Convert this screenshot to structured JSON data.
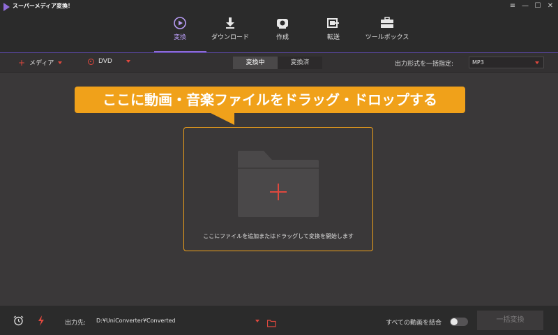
{
  "app": {
    "title": "スーパーメディア変換！"
  },
  "window_controls": [
    {
      "name": "menu-icon",
      "glyph": "≡"
    },
    {
      "name": "minimize-icon",
      "glyph": "—"
    },
    {
      "name": "maximize-icon",
      "glyph": "☐"
    },
    {
      "name": "close-icon",
      "glyph": "✕"
    }
  ],
  "nav": {
    "items": [
      {
        "id": "convert",
        "label": "変換",
        "icon": "play-circle-icon",
        "active": true
      },
      {
        "id": "download",
        "label": "ダウンロード",
        "icon": "download-icon",
        "active": false
      },
      {
        "id": "create",
        "label": "作成",
        "icon": "record-icon",
        "active": false
      },
      {
        "id": "transfer",
        "label": "転送",
        "icon": "transfer-icon",
        "active": false
      },
      {
        "id": "toolbox",
        "label": "ツールボックス",
        "icon": "toolbox-icon",
        "active": false
      }
    ]
  },
  "toolbar": {
    "media_label": "メディア",
    "dvd_label": "DVD",
    "tabs": [
      {
        "label": "変換中",
        "active": true
      },
      {
        "label": "変換済",
        "active": false
      }
    ],
    "format_label": "出力形式を一括指定:",
    "format_value": "MP3"
  },
  "main": {
    "banner_text": "ここに動画・音楽ファイルをドラッグ・ドロップする",
    "drop_hint": "ここにファイルを追加またはドラッグして変換を開始します"
  },
  "bottom": {
    "output_label": "出力先:",
    "output_path": "D:¥UniConverter¥Converted",
    "merge_label": "すべての動画を結合",
    "merge_enabled": false,
    "convert_all_label": "一括変換"
  },
  "colors": {
    "accent": "#8e6bd8",
    "highlight": "#f0a11a",
    "red": "#e0483e",
    "background": "#3a3839",
    "bar": "#2b2b2b"
  }
}
